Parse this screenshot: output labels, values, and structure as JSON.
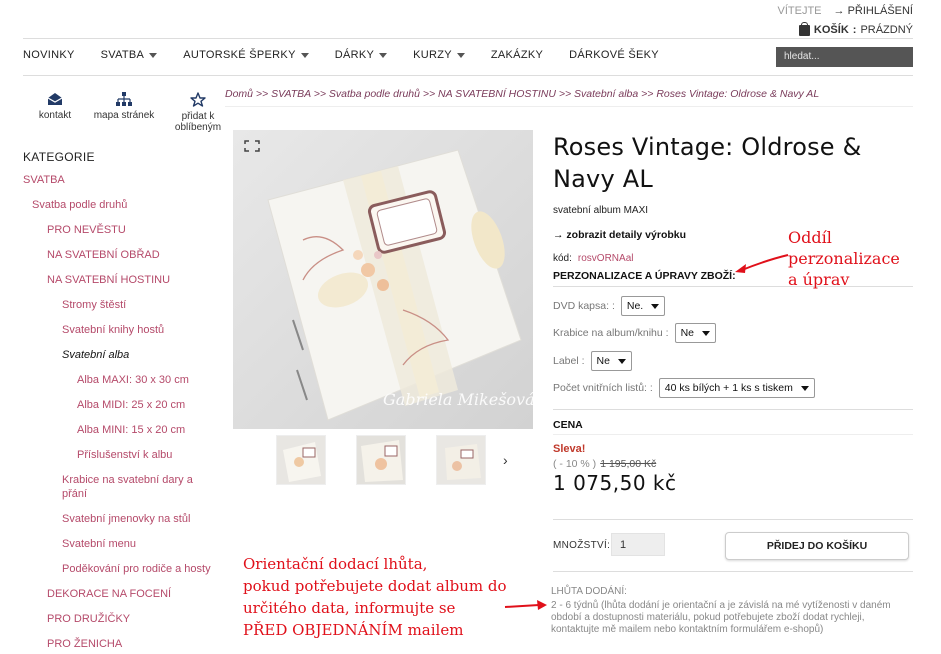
{
  "top": {
    "welcome": "VÍTEJTE",
    "login": "PŘIHLÁŠENÍ",
    "cart_label": "KOŠÍK",
    "cart_status": "PRÁZDNÝ"
  },
  "nav": {
    "items": [
      {
        "label": "NOVINKY",
        "dropdown": false
      },
      {
        "label": "SVATBA",
        "dropdown": true
      },
      {
        "label": "AUTORSKÉ ŠPERKY",
        "dropdown": true
      },
      {
        "label": "DÁRKY",
        "dropdown": true
      },
      {
        "label": "KURZY",
        "dropdown": true
      },
      {
        "label": "ZAKÁZKY",
        "dropdown": false
      },
      {
        "label": "DÁRKOVÉ ŠEKY",
        "dropdown": false
      }
    ],
    "search_placeholder": "hledat..."
  },
  "quick": {
    "contact": "kontakt",
    "sitemap": "mapa stránek",
    "fav1": "přidat k",
    "fav2": "oblíbeným"
  },
  "sidebar": {
    "title": "KATEGORIE",
    "items": [
      {
        "label": "SVATBA",
        "level": 1
      },
      {
        "label": "Svatba podle druhů",
        "level": 2
      },
      {
        "label": "PRO NEVĚSTU",
        "level": 3
      },
      {
        "label": "NA SVATEBNÍ OBŘAD",
        "level": 3
      },
      {
        "label": "NA SVATEBNÍ HOSTINU",
        "level": 3
      },
      {
        "label": "Stromy štěstí",
        "level": 4
      },
      {
        "label": "Svatební knihy hostů",
        "level": 4
      },
      {
        "label": "Svatební alba",
        "level": 4
      },
      {
        "label": "Alba MAXI: 30 x 30 cm",
        "level": 5
      },
      {
        "label": "Alba MIDI: 25 x 20 cm",
        "level": 5
      },
      {
        "label": "Alba MINI: 15 x 20 cm",
        "level": 5
      },
      {
        "label": "Příslušenství k albu",
        "level": 5
      },
      {
        "label": "Krabice na svatební dary a",
        "label2": "přání",
        "level": 4
      },
      {
        "label": "Svatební jmenovky na stůl",
        "level": 4
      },
      {
        "label": "Svatební menu",
        "level": 4
      },
      {
        "label": "Poděkování pro rodiče a hosty",
        "level": 4
      },
      {
        "label": "DEKORACE NA FOCENÍ",
        "level": 3
      },
      {
        "label": "PRO DRUŽIČKY",
        "level": 3
      },
      {
        "label": "PRO ŽENICHA",
        "level": 3
      }
    ]
  },
  "breadcrumb": "Domů >> SVATBA >> Svatba podle druhů >> NA SVATEBNÍ HOSTINU >> Svatební alba >> Roses Vintage: Oldrose & Navy AL",
  "product": {
    "title": "Roses Vintage: Oldrose & Navy AL",
    "subtitle": "svatební album MAXI",
    "details_link": "→ zobrazit detaily výrobku",
    "code_label": "kód:",
    "code_value": "rosvORNAal",
    "perso_heading": "PERZONALIZACE A ÚPRAVY ZBOŽÍ:",
    "options": [
      {
        "label": "DVD kapsa: :",
        "value": "Ne."
      },
      {
        "label": "Krabice na album/knihu :",
        "value": "Ne"
      },
      {
        "label": "Label :",
        "value": "Ne"
      },
      {
        "label": "Počet vnitřních listů: :",
        "value": "40 ks bílých + 1 ks s tiskem"
      }
    ],
    "price_heading": "CENA",
    "discount_label": "Sleva!",
    "discount_pct": "( - 10 % )",
    "old_price": "1 195,00 Kč",
    "price": "1 075,50 kč",
    "qty_label": "MNOŽSTVÍ:",
    "qty_value": "1",
    "add_button": "PŘIDEJ DO KOŠÍKU",
    "delivery_label": "LHŮTA DODÁNÍ:",
    "delivery_text": "2 - 6 týdnů (lhůta dodání je orientační a je závislá na mé vytíženosti v daném období a dostupnosti materiálu, pokud potřebujete zboží dodat rychleji, kontaktujte mě mailem nebo kontaktním formulářem e-shopů)"
  },
  "annotations": {
    "a1": [
      "Oddíl",
      "perzonalizace",
      "a úprav"
    ],
    "a2": [
      "Orientační dodací lhůta,",
      "pokud potřebujete dodat album do",
      "určitého data, informujte se",
      "PŘED OBJEDNÁNÍM mailem"
    ]
  },
  "photo": {
    "watermark": "Gabriela Mikešová"
  }
}
